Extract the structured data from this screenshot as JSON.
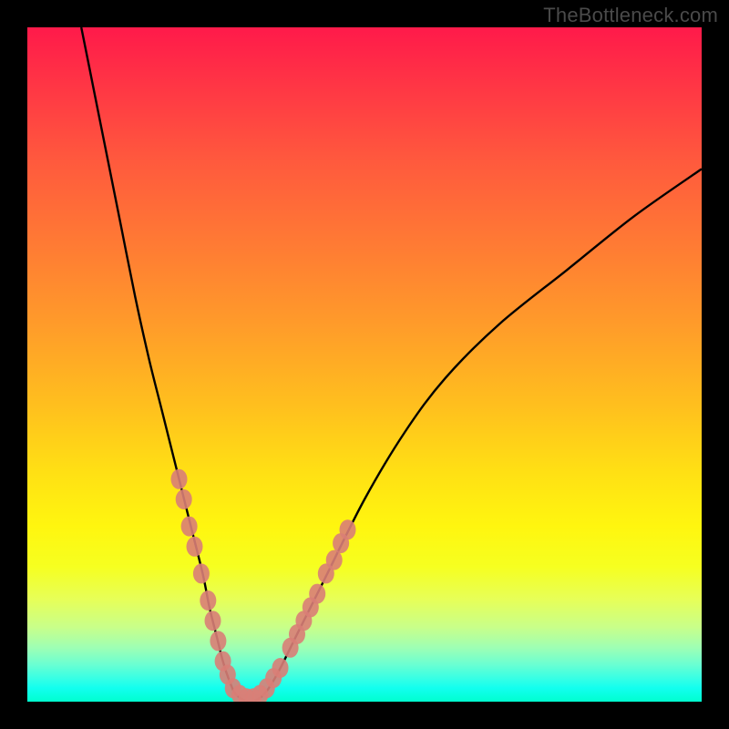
{
  "watermark": "TheBottleneck.com",
  "chart_data": {
    "type": "line",
    "title": "",
    "xlabel": "",
    "ylabel": "",
    "xlim": [
      0,
      100
    ],
    "ylim": [
      0,
      100
    ],
    "series": [
      {
        "name": "bottleneck-curve",
        "x": [
          8,
          10,
          12,
          14,
          16,
          18,
          20,
          22,
          24,
          26,
          27,
          28,
          29,
          30,
          31,
          33,
          35,
          37,
          40,
          44,
          50,
          56,
          62,
          70,
          80,
          90,
          100
        ],
        "values": [
          100,
          90,
          80,
          70,
          60,
          51,
          43,
          35,
          27,
          19,
          14,
          10,
          6,
          3,
          1,
          0,
          1,
          4,
          10,
          18,
          30,
          40,
          48,
          56,
          64,
          72,
          79
        ]
      }
    ],
    "markers": {
      "name": "sample-points",
      "points": [
        {
          "x": 22.5,
          "y": 33
        },
        {
          "x": 23.2,
          "y": 30
        },
        {
          "x": 24.0,
          "y": 26
        },
        {
          "x": 24.8,
          "y": 23
        },
        {
          "x": 25.8,
          "y": 19
        },
        {
          "x": 26.8,
          "y": 15
        },
        {
          "x": 27.5,
          "y": 12
        },
        {
          "x": 28.3,
          "y": 9
        },
        {
          "x": 29.0,
          "y": 6
        },
        {
          "x": 29.7,
          "y": 4
        },
        {
          "x": 30.5,
          "y": 2
        },
        {
          "x": 31.5,
          "y": 1
        },
        {
          "x": 32.5,
          "y": 0.5
        },
        {
          "x": 33.5,
          "y": 0.5
        },
        {
          "x": 34.5,
          "y": 1
        },
        {
          "x": 35.5,
          "y": 2
        },
        {
          "x": 36.5,
          "y": 3.5
        },
        {
          "x": 37.5,
          "y": 5
        },
        {
          "x": 39.0,
          "y": 8
        },
        {
          "x": 40.0,
          "y": 10
        },
        {
          "x": 41.0,
          "y": 12
        },
        {
          "x": 42.0,
          "y": 14
        },
        {
          "x": 43.0,
          "y": 16
        },
        {
          "x": 44.3,
          "y": 19
        },
        {
          "x": 45.5,
          "y": 21
        },
        {
          "x": 46.5,
          "y": 23.5
        },
        {
          "x": 47.5,
          "y": 25.5
        }
      ]
    }
  },
  "colors": {
    "curve": "#000000",
    "markers": "#d97e77"
  }
}
